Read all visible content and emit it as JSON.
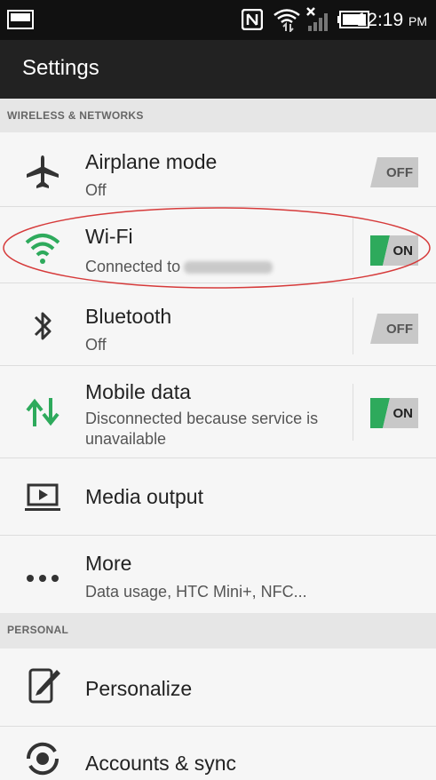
{
  "status_bar": {
    "time": "12:19",
    "ampm": "PM"
  },
  "header": {
    "title": "Settings"
  },
  "sections": {
    "wireless": "WIRELESS & NETWORKS",
    "personal": "PERSONAL"
  },
  "items": {
    "airplane": {
      "label": "Airplane mode",
      "sub": "Off",
      "toggle": "OFF"
    },
    "wifi": {
      "label": "Wi-Fi",
      "sub": "Connected to",
      "toggle": "ON"
    },
    "bluetooth": {
      "label": "Bluetooth",
      "sub": "Off",
      "toggle": "OFF"
    },
    "mobile": {
      "label": "Mobile data",
      "sub1": "Disconnected because service is",
      "sub2": "unavailable",
      "toggle": "ON"
    },
    "media": {
      "label": "Media output"
    },
    "more": {
      "label": "More",
      "sub": "Data usage, HTC Mini+, NFC..."
    },
    "personalize": {
      "label": "Personalize"
    },
    "accounts": {
      "label": "Accounts & sync"
    }
  },
  "colors": {
    "on": "#2eaa5c",
    "off": "#c4c4c4",
    "highlight": "#d63a3a"
  }
}
